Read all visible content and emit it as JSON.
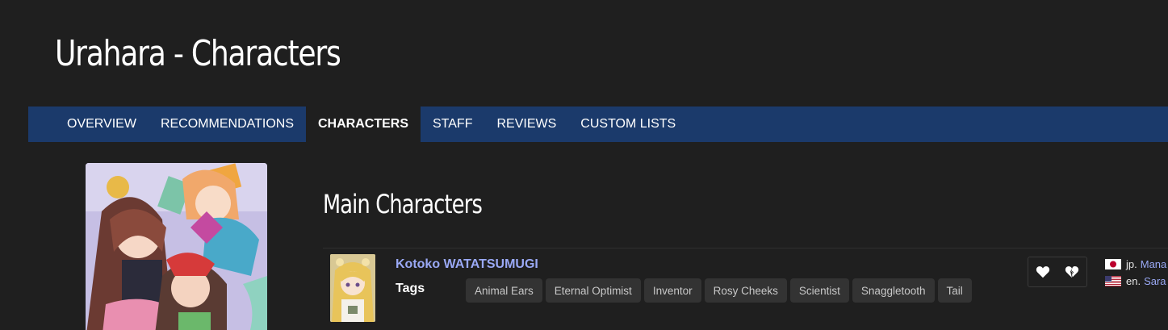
{
  "header": {
    "title": "Urahara - Characters"
  },
  "tabs": [
    {
      "label": "OVERVIEW",
      "active": false
    },
    {
      "label": "RECOMMENDATIONS",
      "active": false
    },
    {
      "label": "CHARACTERS",
      "active": true
    },
    {
      "label": "STAFF",
      "active": false
    },
    {
      "label": "REVIEWS",
      "active": false
    },
    {
      "label": "CUSTOM LISTS",
      "active": false
    }
  ],
  "section": {
    "title": "Main Characters"
  },
  "character": {
    "name": "Kotoko WATATSUMUGI",
    "tags_label": "Tags",
    "tags": [
      "Animal Ears",
      "Eternal Optimist",
      "Inventor",
      "Rosy Cheeks",
      "Scientist",
      "Snaggletooth",
      "Tail"
    ],
    "voice_actors": [
      {
        "lang": "jp.",
        "name": "Mana",
        "flag": "japan-flag-icon"
      },
      {
        "lang": "en.",
        "name": "Sara",
        "flag": "usa-flag-icon"
      }
    ]
  },
  "colors": {
    "background": "#1f1f1f",
    "tabbar": "#1b3a6b",
    "link": "#9aa9f5",
    "tag_bg": "#333333"
  }
}
